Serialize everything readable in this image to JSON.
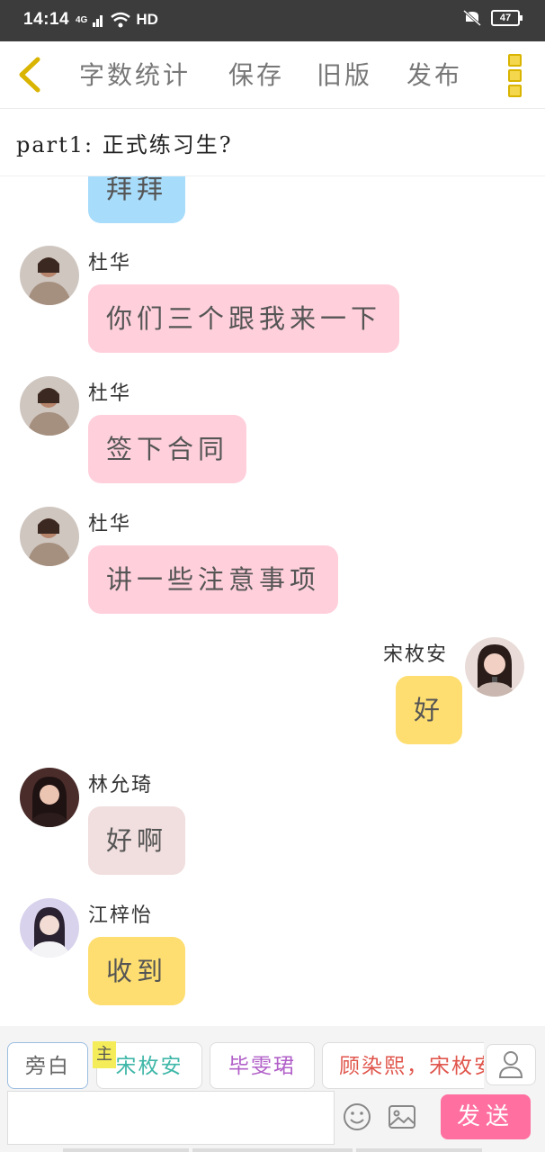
{
  "status": {
    "time": "14:14",
    "network": "4G",
    "hd": "HD",
    "battery": "47"
  },
  "toolbar": {
    "word_count": "字数统计",
    "save": "保存",
    "old_version": "旧版",
    "publish": "发布"
  },
  "part": {
    "title": "part1: 正式练习生?"
  },
  "colors": {
    "pink": "#ffd0dc",
    "blue": "#a7dcfb",
    "yellow": "#fede70",
    "mauve": "#f1dede",
    "send": "#ff6fa0"
  },
  "messages": [
    {
      "text": "拜拜",
      "color": "#a7dcfb"
    },
    {
      "name": "杜华",
      "text": "你们三个跟我来一下",
      "color": "#ffd0dc"
    },
    {
      "name": "杜华",
      "text": "签下合同",
      "color": "#ffd0dc"
    },
    {
      "name": "杜华",
      "text": "讲一些注意事项",
      "color": "#ffd0dc"
    },
    {
      "name": "宋枚安",
      "text": "好",
      "color": "#fede70",
      "side": "right"
    },
    {
      "name": "林允琦",
      "text": "好啊",
      "color": "#f1dede"
    },
    {
      "name": "江梓怡",
      "text": "收到",
      "color": "#fede70"
    }
  ],
  "roles": {
    "narration": "旁白",
    "main_tag": "主",
    "song": "宋枚安",
    "bi": "毕雯珺",
    "multi": "顾染熙，宋枚安"
  },
  "composer": {
    "send": "发送"
  }
}
